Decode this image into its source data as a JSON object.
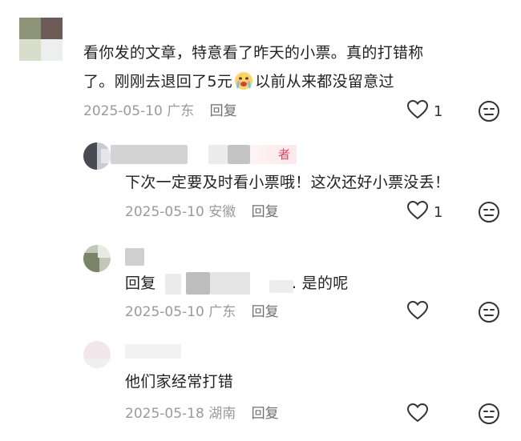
{
  "comments": [
    {
      "text_lines": [
        "看你发的文章，特意看了昨天的小票。真的打错称",
        "了。刚刚去退回了5元",
        "以前从来都没留意过"
      ],
      "emoji": "crying-face",
      "date": "2025-05-10",
      "location": "广东",
      "reply_label": "回复",
      "likes": "1"
    },
    {
      "author_badge": "者",
      "text": "下次一定要及时看小票哦！这次还好小票没丢！",
      "date": "2025-05-10",
      "location": "安徽",
      "reply_label": "回复",
      "likes": "1"
    },
    {
      "text_prefix": "回复",
      "text_suffix": ". 是的呢",
      "date": "2025-05-10",
      "location": "广东",
      "reply_label": "回复",
      "likes": ""
    },
    {
      "text": "他们家经常打错",
      "date": "2025-05-18",
      "location": "湖南",
      "reply_label": "回复",
      "likes": ""
    }
  ],
  "icons": {
    "like": "heart-outline-icon",
    "dislike": "neutral-face-icon"
  },
  "colors": {
    "meta": "#9a9a9a",
    "badge_bg": "#fde8ec",
    "badge_text": "#e0475f"
  }
}
